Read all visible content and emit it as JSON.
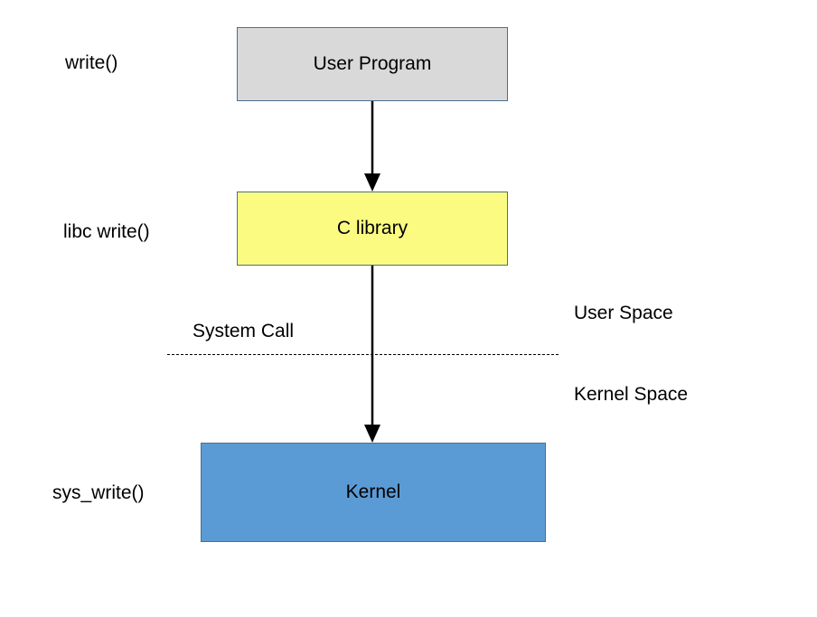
{
  "boxes": {
    "user_program": "User Program",
    "c_library": "C library",
    "kernel": "Kernel"
  },
  "labels": {
    "write": "write()",
    "libc_write": "libc write()",
    "system_call": "System Call",
    "user_space": "User Space",
    "kernel_space": "Kernel Space",
    "sys_write": "sys_write()"
  }
}
